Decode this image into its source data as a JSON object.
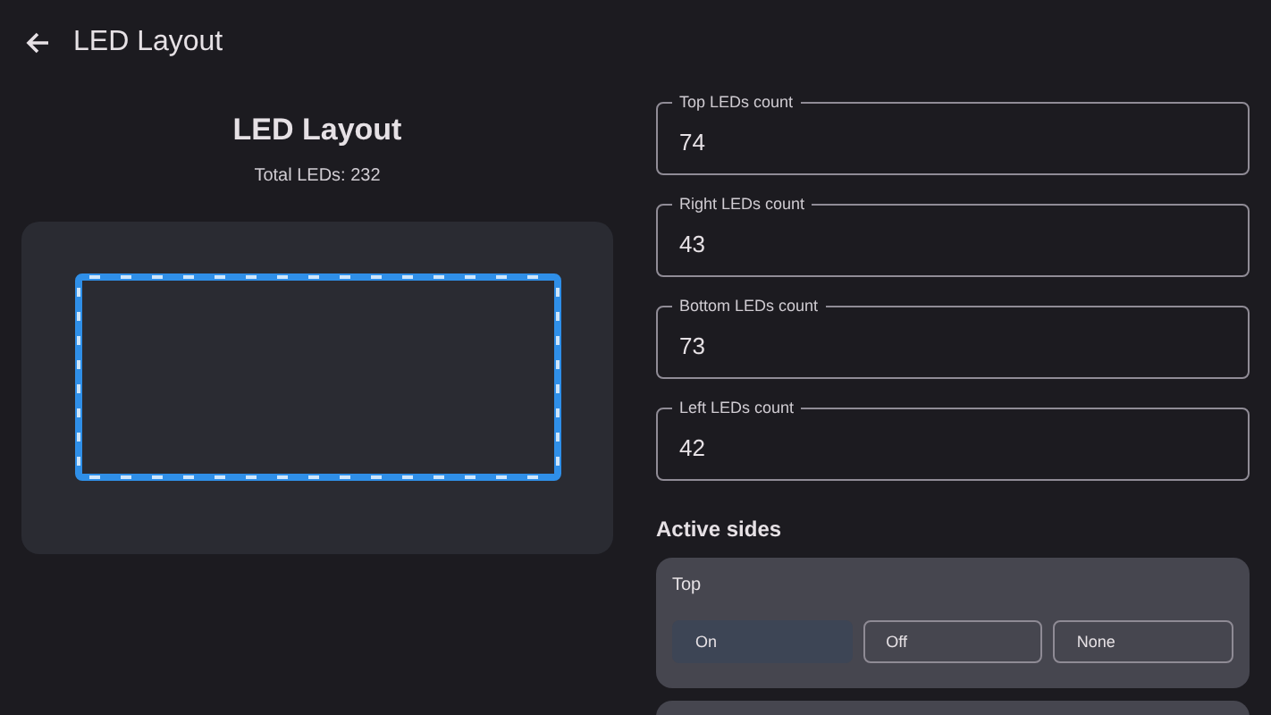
{
  "app_bar": {
    "title": "LED Layout"
  },
  "layout": {
    "title": "LED Layout",
    "total": "Total LEDs: 232"
  },
  "fields": [
    {
      "label": "Top LEDs count",
      "value": "74"
    },
    {
      "label": "Right LEDs count",
      "value": "43"
    },
    {
      "label": "Bottom LEDs count",
      "value": "73"
    },
    {
      "label": "Left LEDs count",
      "value": "42"
    }
  ],
  "active_sides": {
    "heading": "Active sides",
    "sides": [
      {
        "name": "Top",
        "options": [
          {
            "label": "On",
            "selected": true
          },
          {
            "label": "Off",
            "selected": false
          },
          {
            "label": "None",
            "selected": false
          }
        ]
      }
    ]
  }
}
